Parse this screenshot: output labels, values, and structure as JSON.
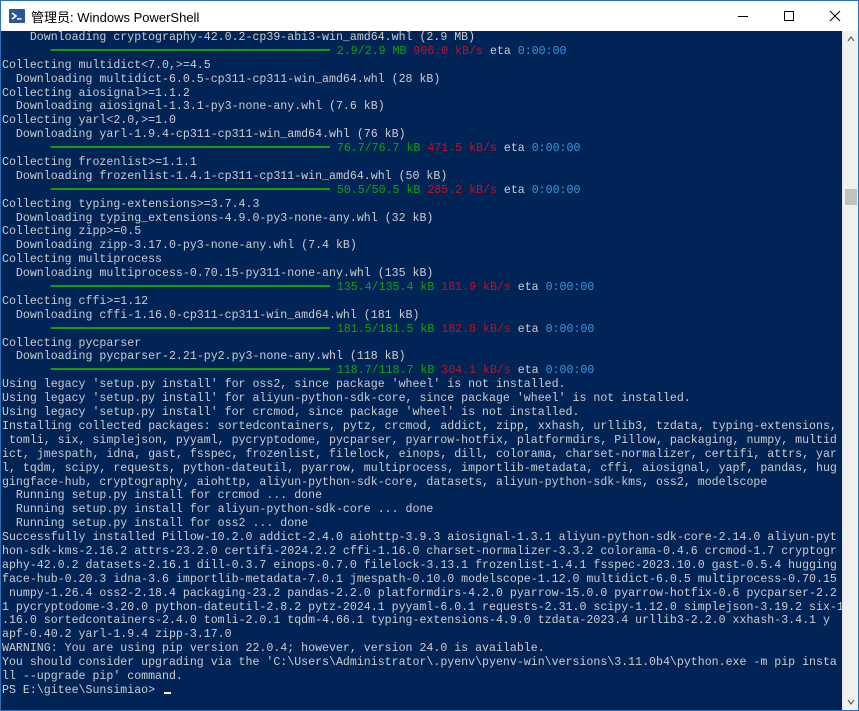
{
  "window": {
    "title": "管理员: Windows PowerShell"
  },
  "controls": {
    "minimize": "minimize",
    "maximize": "maximize",
    "close": "close"
  },
  "console": {
    "lines": [
      {
        "parts": [
          {
            "t": "    Downloading cryptography-42.0.2-cp39-abi3-win_amd64.whl (2.9 MB)"
          }
        ]
      },
      {
        "parts": [
          {
            "t": "       ",
            "k": ""
          },
          {
            "t": "━━━━━━━━━━━━━━━━━━━━━━━━━━━━━━━━━━━━━━━━ ",
            "k": "g"
          },
          {
            "t": "2.9/2.9 MB",
            "k": "g"
          },
          {
            "t": " 906.0 kB/s",
            "k": "r"
          },
          {
            "t": " eta "
          },
          {
            "t": "0:00:00",
            "k": "c"
          }
        ]
      },
      {
        "parts": [
          {
            "t": "Collecting multidict<7.0,>=4.5"
          }
        ]
      },
      {
        "parts": [
          {
            "t": "  Downloading multidict-6.0.5-cp311-cp311-win_amd64.whl (28 kB)"
          }
        ]
      },
      {
        "parts": [
          {
            "t": "Collecting aiosignal>=1.1.2"
          }
        ]
      },
      {
        "parts": [
          {
            "t": "  Downloading aiosignal-1.3.1-py3-none-any.whl (7.6 kB)"
          }
        ]
      },
      {
        "parts": [
          {
            "t": "Collecting yarl<2.0,>=1.0"
          }
        ]
      },
      {
        "parts": [
          {
            "t": "  Downloading yarl-1.9.4-cp311-cp311-win_amd64.whl (76 kB)"
          }
        ]
      },
      {
        "parts": [
          {
            "t": "       ",
            "k": ""
          },
          {
            "t": "━━━━━━━━━━━━━━━━━━━━━━━━━━━━━━━━━━━━━━━━ ",
            "k": "g"
          },
          {
            "t": "76.7/76.7 kB",
            "k": "g"
          },
          {
            "t": " 471.5 kB/s",
            "k": "r"
          },
          {
            "t": " eta "
          },
          {
            "t": "0:00:00",
            "k": "c"
          }
        ]
      },
      {
        "parts": [
          {
            "t": "Collecting frozenlist>=1.1.1"
          }
        ]
      },
      {
        "parts": [
          {
            "t": "  Downloading frozenlist-1.4.1-cp311-cp311-win_amd64.whl (50 kB)"
          }
        ]
      },
      {
        "parts": [
          {
            "t": "       ",
            "k": ""
          },
          {
            "t": "━━━━━━━━━━━━━━━━━━━━━━━━━━━━━━━━━━━━━━━━ ",
            "k": "g"
          },
          {
            "t": "50.5/50.5 kB",
            "k": "g"
          },
          {
            "t": " 285.2 kB/s",
            "k": "r"
          },
          {
            "t": " eta "
          },
          {
            "t": "0:00:00",
            "k": "c"
          }
        ]
      },
      {
        "parts": [
          {
            "t": "Collecting typing-extensions>=3.7.4.3"
          }
        ]
      },
      {
        "parts": [
          {
            "t": "  Downloading typing_extensions-4.9.0-py3-none-any.whl (32 kB)"
          }
        ]
      },
      {
        "parts": [
          {
            "t": "Collecting zipp>=0.5"
          }
        ]
      },
      {
        "parts": [
          {
            "t": "  Downloading zipp-3.17.0-py3-none-any.whl (7.4 kB)"
          }
        ]
      },
      {
        "parts": [
          {
            "t": "Collecting multiprocess"
          }
        ]
      },
      {
        "parts": [
          {
            "t": "  Downloading multiprocess-0.70.15-py311-none-any.whl (135 kB)"
          }
        ]
      },
      {
        "parts": [
          {
            "t": "       ",
            "k": ""
          },
          {
            "t": "━━━━━━━━━━━━━━━━━━━━━━━━━━━━━━━━━━━━━━━━ ",
            "k": "g"
          },
          {
            "t": "135.4/135.4 kB",
            "k": "g"
          },
          {
            "t": " 181.9 kB/s",
            "k": "r"
          },
          {
            "t": " eta "
          },
          {
            "t": "0:00:00",
            "k": "c"
          }
        ]
      },
      {
        "parts": [
          {
            "t": "Collecting cffi>=1.12"
          }
        ]
      },
      {
        "parts": [
          {
            "t": "  Downloading cffi-1.16.0-cp311-cp311-win_amd64.whl (181 kB)"
          }
        ]
      },
      {
        "parts": [
          {
            "t": "       ",
            "k": ""
          },
          {
            "t": "━━━━━━━━━━━━━━━━━━━━━━━━━━━━━━━━━━━━━━━━ ",
            "k": "g"
          },
          {
            "t": "181.5/181.5 kB",
            "k": "g"
          },
          {
            "t": " 182.8 kB/s",
            "k": "r"
          },
          {
            "t": " eta "
          },
          {
            "t": "0:00:00",
            "k": "c"
          }
        ]
      },
      {
        "parts": [
          {
            "t": "Collecting pycparser"
          }
        ]
      },
      {
        "parts": [
          {
            "t": "  Downloading pycparser-2.21-py2.py3-none-any.whl (118 kB)"
          }
        ]
      },
      {
        "parts": [
          {
            "t": "       ",
            "k": ""
          },
          {
            "t": "━━━━━━━━━━━━━━━━━━━━━━━━━━━━━━━━━━━━━━━━ ",
            "k": "g"
          },
          {
            "t": "118.7/118.7 kB",
            "k": "g"
          },
          {
            "t": " 304.1 kB/s",
            "k": "r"
          },
          {
            "t": " eta "
          },
          {
            "t": "0:00:00",
            "k": "c"
          }
        ]
      },
      {
        "parts": [
          {
            "t": "Using legacy 'setup.py install' for oss2, since package 'wheel' is not installed."
          }
        ]
      },
      {
        "parts": [
          {
            "t": "Using legacy 'setup.py install' for aliyun-python-sdk-core, since package 'wheel' is not installed."
          }
        ]
      },
      {
        "parts": [
          {
            "t": "Using legacy 'setup.py install' for crcmod, since package 'wheel' is not installed."
          }
        ]
      },
      {
        "parts": [
          {
            "t": "Installing collected packages: sortedcontainers, pytz, crcmod, addict, zipp, xxhash, urllib3, tzdata, typing-extensions,"
          }
        ]
      },
      {
        "parts": [
          {
            "t": " tomli, six, simplejson, pyyaml, pycryptodome, pycparser, pyarrow-hotfix, platformdirs, Pillow, packaging, numpy, multid"
          }
        ]
      },
      {
        "parts": [
          {
            "t": "ict, jmespath, idna, gast, fsspec, frozenlist, filelock, einops, dill, colorama, charset-normalizer, certifi, attrs, yar"
          }
        ]
      },
      {
        "parts": [
          {
            "t": "l, tqdm, scipy, requests, python-dateutil, pyarrow, multiprocess, importlib-metadata, cffi, aiosignal, yapf, pandas, hug"
          }
        ]
      },
      {
        "parts": [
          {
            "t": "gingface-hub, cryptography, aiohttp, aliyun-python-sdk-core, datasets, aliyun-python-sdk-kms, oss2, modelscope"
          }
        ]
      },
      {
        "parts": [
          {
            "t": "  Running setup.py install for crcmod ... done"
          }
        ]
      },
      {
        "parts": [
          {
            "t": "  Running setup.py install for aliyun-python-sdk-core ... done"
          }
        ]
      },
      {
        "parts": [
          {
            "t": "  Running setup.py install for oss2 ... done"
          }
        ]
      },
      {
        "parts": [
          {
            "t": "Successfully installed Pillow-10.2.0 addict-2.4.0 aiohttp-3.9.3 aiosignal-1.3.1 aliyun-python-sdk-core-2.14.0 aliyun-pyt"
          }
        ]
      },
      {
        "parts": [
          {
            "t": "hon-sdk-kms-2.16.2 attrs-23.2.0 certifi-2024.2.2 cffi-1.16.0 charset-normalizer-3.3.2 colorama-0.4.6 crcmod-1.7 cryptogr"
          }
        ]
      },
      {
        "parts": [
          {
            "t": "aphy-42.0.2 datasets-2.16.1 dill-0.3.7 einops-0.7.0 filelock-3.13.1 frozenlist-1.4.1 fsspec-2023.10.0 gast-0.5.4 hugging"
          }
        ]
      },
      {
        "parts": [
          {
            "t": "face-hub-0.20.3 idna-3.6 importlib-metadata-7.0.1 jmespath-0.10.0 modelscope-1.12.0 multidict-6.0.5 multiprocess-0.70.15"
          }
        ]
      },
      {
        "parts": [
          {
            "t": " numpy-1.26.4 oss2-2.18.4 packaging-23.2 pandas-2.2.0 platformdirs-4.2.0 pyarrow-15.0.0 pyarrow-hotfix-0.6 pycparser-2.2"
          }
        ]
      },
      {
        "parts": [
          {
            "t": "1 pycryptodome-3.20.0 python-dateutil-2.8.2 pytz-2024.1 pyyaml-6.0.1 requests-2.31.0 scipy-1.12.0 simplejson-3.19.2 six-1"
          }
        ]
      },
      {
        "parts": [
          {
            "t": ".16.0 sortedcontainers-2.4.0 tomli-2.0.1 tqdm-4.66.1 typing-extensions-4.9.0 tzdata-2023.4 urllib3-2.2.0 xxhash-3.4.1 y"
          }
        ]
      },
      {
        "parts": [
          {
            "t": "apf-0.40.2 yarl-1.9.4 zipp-3.17.0"
          }
        ]
      },
      {
        "parts": [
          {
            "t": "WARNING: You are using pip version 22.0.4; however, version 24.0 is available."
          }
        ]
      },
      {
        "parts": [
          {
            "t": "You should consider upgrading via the 'C:\\Users\\Administrator\\.pyenv\\pyenv-win\\versions\\3.11.0b4\\python.exe -m pip insta"
          }
        ]
      },
      {
        "parts": [
          {
            "t": "ll --upgrade pip' command."
          }
        ]
      },
      {
        "parts": [
          {
            "t": "PS E:\\gitee\\Sunsimiao> "
          }
        ],
        "cursor": true
      }
    ]
  },
  "colors": {
    "console_bg": "#012456",
    "console_text": "#cccccc",
    "progress_green": "#13a10e",
    "speed_red": "#c50f1f",
    "eta_cyan": "#3a96dd",
    "cursor": "#f9f1a5"
  },
  "icons": {
    "app": "powershell-icon",
    "minimize": "minimize-icon",
    "maximize": "maximize-icon",
    "close": "close-icon",
    "scroll_up": "chevron-up-icon",
    "scroll_down": "chevron-down-icon"
  }
}
